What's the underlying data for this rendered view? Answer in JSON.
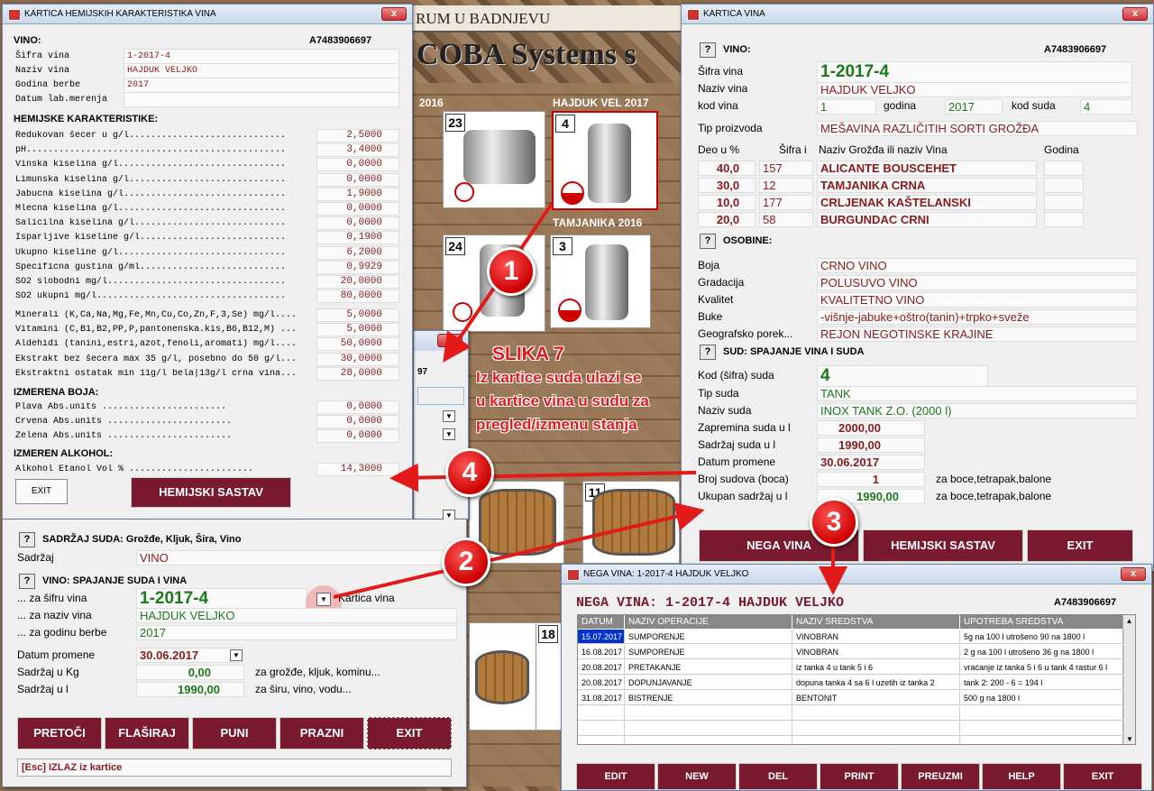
{
  "background": {
    "title": "RUM U BADNJEVU",
    "brand": "COBA Systems s",
    "tiles": [
      "23",
      "4",
      "24",
      "3",
      "11",
      "18"
    ],
    "tank_labels": [
      "2016",
      "HAJDUK VEL 2017",
      "TAMJANIKA 2016"
    ]
  },
  "callout": {
    "title": "SLIKA 7",
    "lines": [
      "Iz kartice suda ulazi se",
      "u kartice vina u sudu za",
      "pregled/izmenu stanja"
    ]
  },
  "markers": [
    "1",
    "2",
    "3",
    "4"
  ],
  "chem": {
    "title": "KARTICA HEMIJSKIH KARAKTERISTIKA VINA",
    "close": "x",
    "vino_label": "VINO:",
    "code": "A7483906697",
    "fields": [
      {
        "label": "Šifra vina",
        "value": "1-2017-4"
      },
      {
        "label": "Naziv vina",
        "value": "HAJDUK VELJKO"
      },
      {
        "label": "Godina berbe",
        "value": "2017"
      },
      {
        "label": "Datum lab.merenja",
        "value": ""
      }
    ],
    "hem_header": "HEMIJSKE KARAKTERISTIKE:",
    "rows": [
      {
        "n": "Redukovan šecer u g/l.............................",
        "v": "2,5000"
      },
      {
        "n": "pH................................................",
        "v": "3,4000"
      },
      {
        "n": "Vinska kiselina g/l...............................",
        "v": "0,0000"
      },
      {
        "n": "Limunska kiselina g/l.............................",
        "v": "0,0000"
      },
      {
        "n": "Jabucna kiselina g/l..............................",
        "v": "1,9000"
      },
      {
        "n": "Mlecna kiselina g/l...............................",
        "v": "0,0000"
      },
      {
        "n": "Salicilna kiselina g/l............................",
        "v": "0,0000"
      },
      {
        "n": "Isparljive kiseline g/l...........................",
        "v": "0,1900"
      },
      {
        "n": "Ukupno kiseline g/l...............................",
        "v": "6,2000"
      },
      {
        "n": "Specificna gustina g/ml...........................",
        "v": "0,9929"
      },
      {
        "n": "SO2 slobodni mg/l.................................",
        "v": "20,0000"
      },
      {
        "n": "SO2 ukupni mg/l...................................",
        "v": "80,0000"
      }
    ],
    "rows2": [
      {
        "n": "Minerali (K,Ca,Na,Mg,Fe,Mn,Cu,Co,Zn,F,3,Se) mg/l....",
        "v": "5,0000"
      },
      {
        "n": "Vitamini (C,B1,B2,PP,P,pantonenska.kis,B6,B12,M) ...",
        "v": "5,0000"
      },
      {
        "n": "Aldehidi (tanini,estri,azot,fenoli,aromati) mg/l....",
        "v": "50,0000"
      },
      {
        "n": "Ekstrakt bez šecera max 35 g/l, posebno do 50 g/l...",
        "v": "30,0000"
      },
      {
        "n": "Ekstraktni ostatak min 11g/l bela|13g/l crna vina...",
        "v": "28,0000"
      }
    ],
    "boja_header": "IZMERENA BOJA:",
    "boja": [
      {
        "n": "Plava  Abs.units      .......................",
        "v": "0,0000"
      },
      {
        "n": "Crvena Abs.units      .......................",
        "v": "0,0000"
      },
      {
        "n": "Zelena Abs.units      .......................",
        "v": "0,0000"
      }
    ],
    "alk_header": "IZMEREN ALKOHOL:",
    "alk": {
      "n": "Alkohol Etanol Vol %   .......................",
      "v": "14,3000"
    },
    "exit": "EXIT",
    "sastav": "HEMIJSKI SASTAV"
  },
  "vina": {
    "title": "KARTICA VINA",
    "close": "x",
    "q": "?",
    "vino_label": "VINO:",
    "code": "A7483906697",
    "sifra_label": "Šifra vina",
    "sifra": "1-2017-4",
    "naziv_label": "Naziv vina",
    "naziv": "HAJDUK VELJKO",
    "kod_label": "kod vina",
    "kod": "1",
    "godina_label": "godina",
    "godina": "2017",
    "kodsuda_label": "kod suda",
    "kodsuda": "4",
    "tip_label": "Tip proizvoda",
    "tip": "MEŠAVINA RAZLIČITIH SORTI GROŽĐA",
    "cols": [
      "Deo u %",
      "Šifra i",
      "Naziv Grožđa ili naziv Vina",
      "Godina"
    ],
    "grapes": [
      {
        "p": "40,0",
        "s": "157",
        "n": "ALICANTE BOUSCEHET"
      },
      {
        "p": "30,0",
        "s": "12",
        "n": "TAMJANIKA CRNA"
      },
      {
        "p": "10,0",
        "s": "177",
        "n": "CRLJENAK KAŠTELANSKI"
      },
      {
        "p": "20,0",
        "s": "58",
        "n": "BURGUNDAC CRNI"
      }
    ],
    "osobine_label": "OSOBINE:",
    "osobine": [
      {
        "l": "Boja",
        "v": "CRNO VINO"
      },
      {
        "l": "Gradacija",
        "v": "POLUSUVO VINO"
      },
      {
        "l": "Kvalitet",
        "v": "KVALITETNO VINO"
      },
      {
        "l": "Buke",
        "v": "-višnje-jabuke+oštro(tanin)+trpko+sveže"
      },
      {
        "l": "Geografsko porek...",
        "v": "REJON NEGOTINSKE KRAJINE"
      }
    ],
    "sud_label": "SUD: SPAJANJE VINA I SUDA",
    "kodsud_label": "Kod (šifra) suda",
    "kodsud": "4",
    "tipsuda_label": "Tip suda",
    "tipsuda": "TANK",
    "nazivsuda_label": "Naziv suda",
    "nazivsuda": "INOX TANK Z.O. (2000 l)",
    "zap_label": "Zapremina suda u l",
    "zap": "2000,00",
    "sadr_label": "Sadržaj suda u l",
    "sadr": "1990,00",
    "dat_label": "Datum promene",
    "dat": "30.06.2017",
    "broj_label": "Broj sudova (boca)",
    "broj": "1",
    "broj_note": "za boce,tetrapak,balone",
    "uk_label": "Ukupan sadržaj u l",
    "uk": "1990,00",
    "uk_note": "za boce,tetrapak,balone",
    "btn_nega": "NEGA VINA",
    "btn_hem": "HEMIJSKI SASTAV",
    "btn_exit": "EXIT"
  },
  "suda": {
    "q": "?",
    "close": "x",
    "sadrzaj_header": "SADRŽAJ SUDA: Grožđe, Kljuk, Šira, Vino",
    "sadrzaj_label": "Sadržaj",
    "sadrzaj": "VINO",
    "spajanje_header": "VINO: SPAJANJE SUDA I VINA",
    "sifra_label": "... za šifru vina",
    "sifra": "1-2017-4",
    "kartica": "Kartica vina",
    "naziv_label": "... za naziv vina",
    "naziv": "HAJDUK VELJKO",
    "godina_label": "... za godinu berbe",
    "godina": "2017",
    "dat_label": "Datum promene",
    "dat": "30.06.2017",
    "kg_label": "Sadržaj u Kg",
    "kg": "0,00",
    "kg_note": "za grožđe, kljuk, kominu...",
    "l_label": "Sadržaj u l",
    "l": "1990,00",
    "l_note": "za širu, vino, vodu...",
    "btns": [
      "PRETOČI",
      "FLAŠIRAJ",
      "PUNI",
      "PRAZNI",
      "EXIT"
    ],
    "status": "[Esc] IZLAZ iz kartice"
  },
  "nega": {
    "title": "NEGA VINA: 1-2017-4 HAJDUK VELJKO",
    "close": "x",
    "heading": "NEGA VINA: 1-2017-4 HAJDUK VELJKO",
    "code": "A7483906697",
    "cols": [
      "DATUM",
      "NAZIV OPERACIJE",
      "NAZIV SREDSTVA",
      "UPOTREBA SREDSTVA"
    ],
    "rows": [
      {
        "d": "15.07.2017",
        "o": "SUMPORENJE",
        "s": "VINOBRAN",
        "u": "5g na 100 l utrošeno 90 na 1800 l"
      },
      {
        "d": "16.08.2017",
        "o": "SUMPORENJE",
        "s": "VINOBRAN",
        "u": "2 g na 100 l utrošeno 36 g na 1800 l"
      },
      {
        "d": "20.08.2017",
        "o": "PRETAKANJE",
        "s": "iz tanka 4 u tank 5 i 6",
        "u": "vraćanje iz tanka 5 i 6 u tank 4  rastur 6 l"
      },
      {
        "d": "20.08.2017",
        "o": "DOPUNJAVANJE",
        "s": "dopuna tanka 4 sa 6 l uzetih iz tanka 2",
        "u": "tank 2:  200 - 6 = 194 l"
      },
      {
        "d": "31.08.2017",
        "o": "BISTRENJE",
        "s": "BENTONIT",
        "u": "500 g na 1800 l"
      }
    ],
    "btns": [
      "EDIT",
      "NEW",
      "DEL",
      "PRINT",
      "PREUZMI",
      "HELP",
      "EXIT"
    ]
  },
  "hidden_dialog": {
    "close": "x",
    "code": "97"
  }
}
